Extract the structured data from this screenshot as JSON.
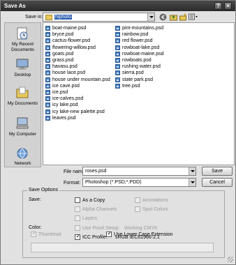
{
  "window": {
    "title": "Save As",
    "help_glyph": "?",
    "close_glyph": "×"
  },
  "toolbar": {
    "save_in_label": "Save in:",
    "save_in_value": "hiphoto",
    "icons": [
      "back-icon",
      "up-folder-icon",
      "new-folder-icon",
      "view-menu-icon"
    ]
  },
  "places": [
    {
      "label": "My Recent Documents",
      "icon": "recent-documents-icon"
    },
    {
      "label": "Desktop",
      "icon": "desktop-icon"
    },
    {
      "label": "My Documents",
      "icon": "my-documents-icon"
    },
    {
      "label": "My Computer",
      "icon": "my-computer-icon"
    },
    {
      "label": "Network",
      "icon": "network-icon"
    }
  ],
  "files": {
    "column1": [
      "boat-maine.psd",
      "bryce.psd",
      "cactus-flower.psd",
      "flowering-willow.psd",
      "goats.psd",
      "grass.psd",
      "havasu.psd",
      "house lace.psd",
      "house under mountain.psd",
      "ice cave.psd",
      "ice.psd",
      "ice-calves.psd",
      "icy lake.psd",
      "icy lake-new palette.psd",
      "leaves.psd"
    ],
    "column2": [
      "pint-mountains.psd",
      "rainbow.psd",
      "red flower.psd",
      "rowboat-lake.psd",
      "rowboat-maine.psd",
      "rowboats.psd",
      "rushing water.psd",
      "sierra.psd",
      "state park.psd",
      "tree.psd"
    ]
  },
  "filename": {
    "label": "File name:",
    "value": "roses.psd"
  },
  "format": {
    "label": "Format:",
    "value": "Photoshop (*.PSD;*.PDD)"
  },
  "buttons": {
    "save": "Save",
    "cancel": "Cancel"
  },
  "save_options": {
    "title": "Save Options",
    "save_label": "Save:",
    "as_copy": "As a Copy",
    "annotations": "Annotations",
    "alpha_channels": "Alpha Channels",
    "spot_colors": "Spot Colors",
    "layers": "Layers",
    "color_label": "Color:",
    "use_proof_setup": "Use Proof Setup:",
    "working_cmyk": "Working CMYK",
    "icc_profile": "ICC Profile:",
    "icc_value": "sRGB IEC61966-2.1",
    "thumbnail": "Thumbnail",
    "lower_case": "Use Lower Case Extension",
    "check_glyph": "✓"
  }
}
